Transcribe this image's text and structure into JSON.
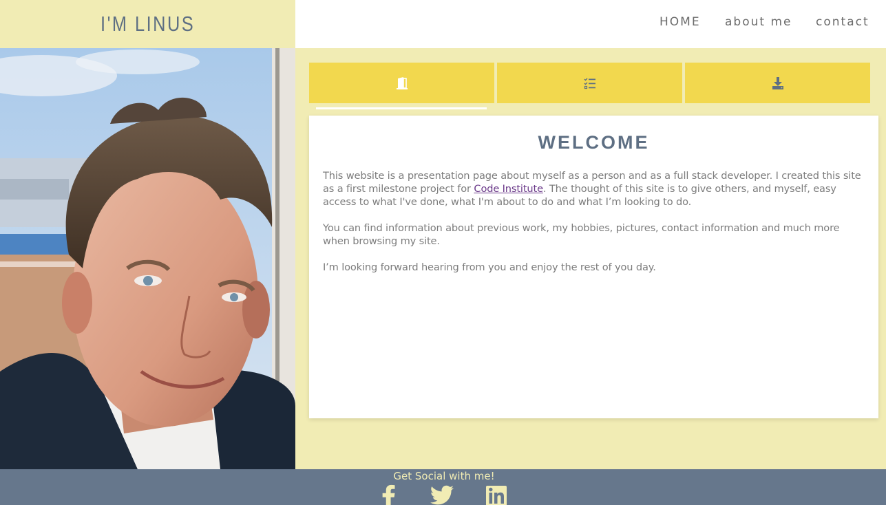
{
  "header": {
    "title": "I'M LINUS",
    "nav": {
      "home": "HOME",
      "about": "about me",
      "contact": "contact"
    }
  },
  "tabs": [
    {
      "icon": "door-open-icon"
    },
    {
      "icon": "tasks-list-icon"
    },
    {
      "icon": "download-icon"
    }
  ],
  "content": {
    "title": "WELCOME",
    "p1_before": "This website is a presentation page about myself as a person and as a full stack developer. I created this site as a first milestone project for ",
    "p1_link": "Code Institute",
    "p1_after": ". The thought of this site is to give others, and myself, easy access to what I've done, what I'm about to do and what I’m looking to do.",
    "p2": "You can find information about previous work, my hobbies, pictures, contact information and much more when browsing my site.",
    "p3": "I’m looking forward hearing from you and enjoy the rest of you day."
  },
  "footer": {
    "text": "Get Social with me!",
    "socials": [
      "facebook-icon",
      "twitter-icon",
      "linkedin-icon"
    ]
  },
  "colors": {
    "background": "#f1ecb4",
    "tab": "#f2d84e",
    "footer": "#66778c",
    "title": "#5e6f83",
    "link": "#6b3a8a"
  }
}
